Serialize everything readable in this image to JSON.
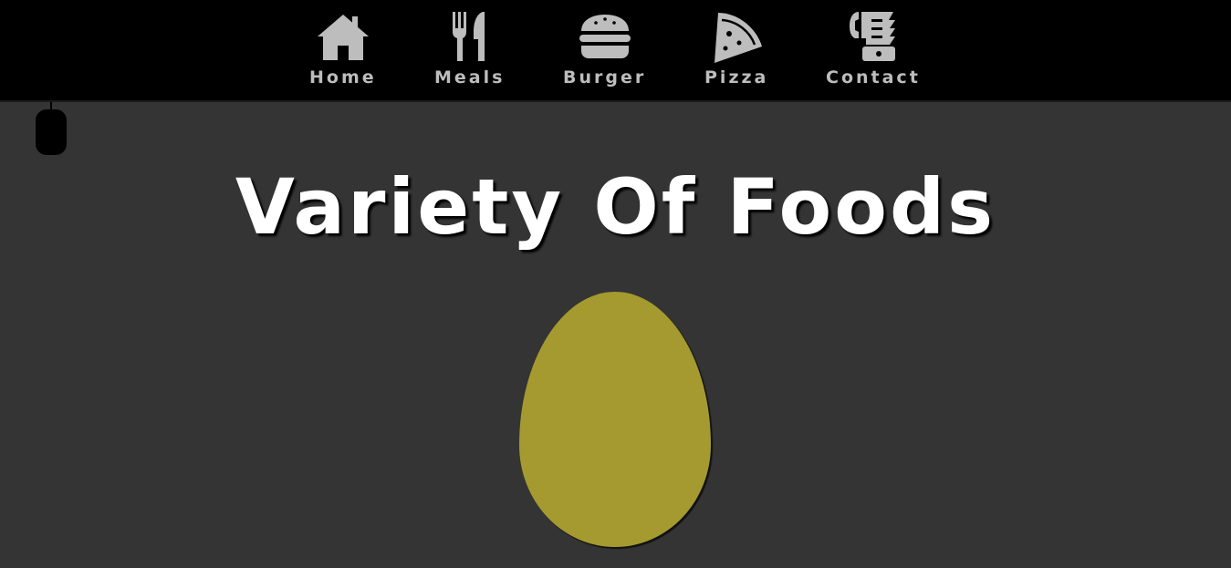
{
  "nav": {
    "items": [
      {
        "label": "Home",
        "icon": "house-icon"
      },
      {
        "label": "Meals",
        "icon": "utensils-icon"
      },
      {
        "label": "Burger",
        "icon": "burger-icon"
      },
      {
        "label": "Pizza",
        "icon": "pizza-slice-icon"
      },
      {
        "label": "Contact",
        "icon": "phone-fax-icon"
      }
    ]
  },
  "hero": {
    "title": "Variety Of Foods"
  },
  "colors": {
    "nav_background": "#000000",
    "page_background": "#343434",
    "nav_icon_color": "#bdbdbd",
    "title_color": "#ffffff",
    "egg_color": "#a59a2f"
  }
}
